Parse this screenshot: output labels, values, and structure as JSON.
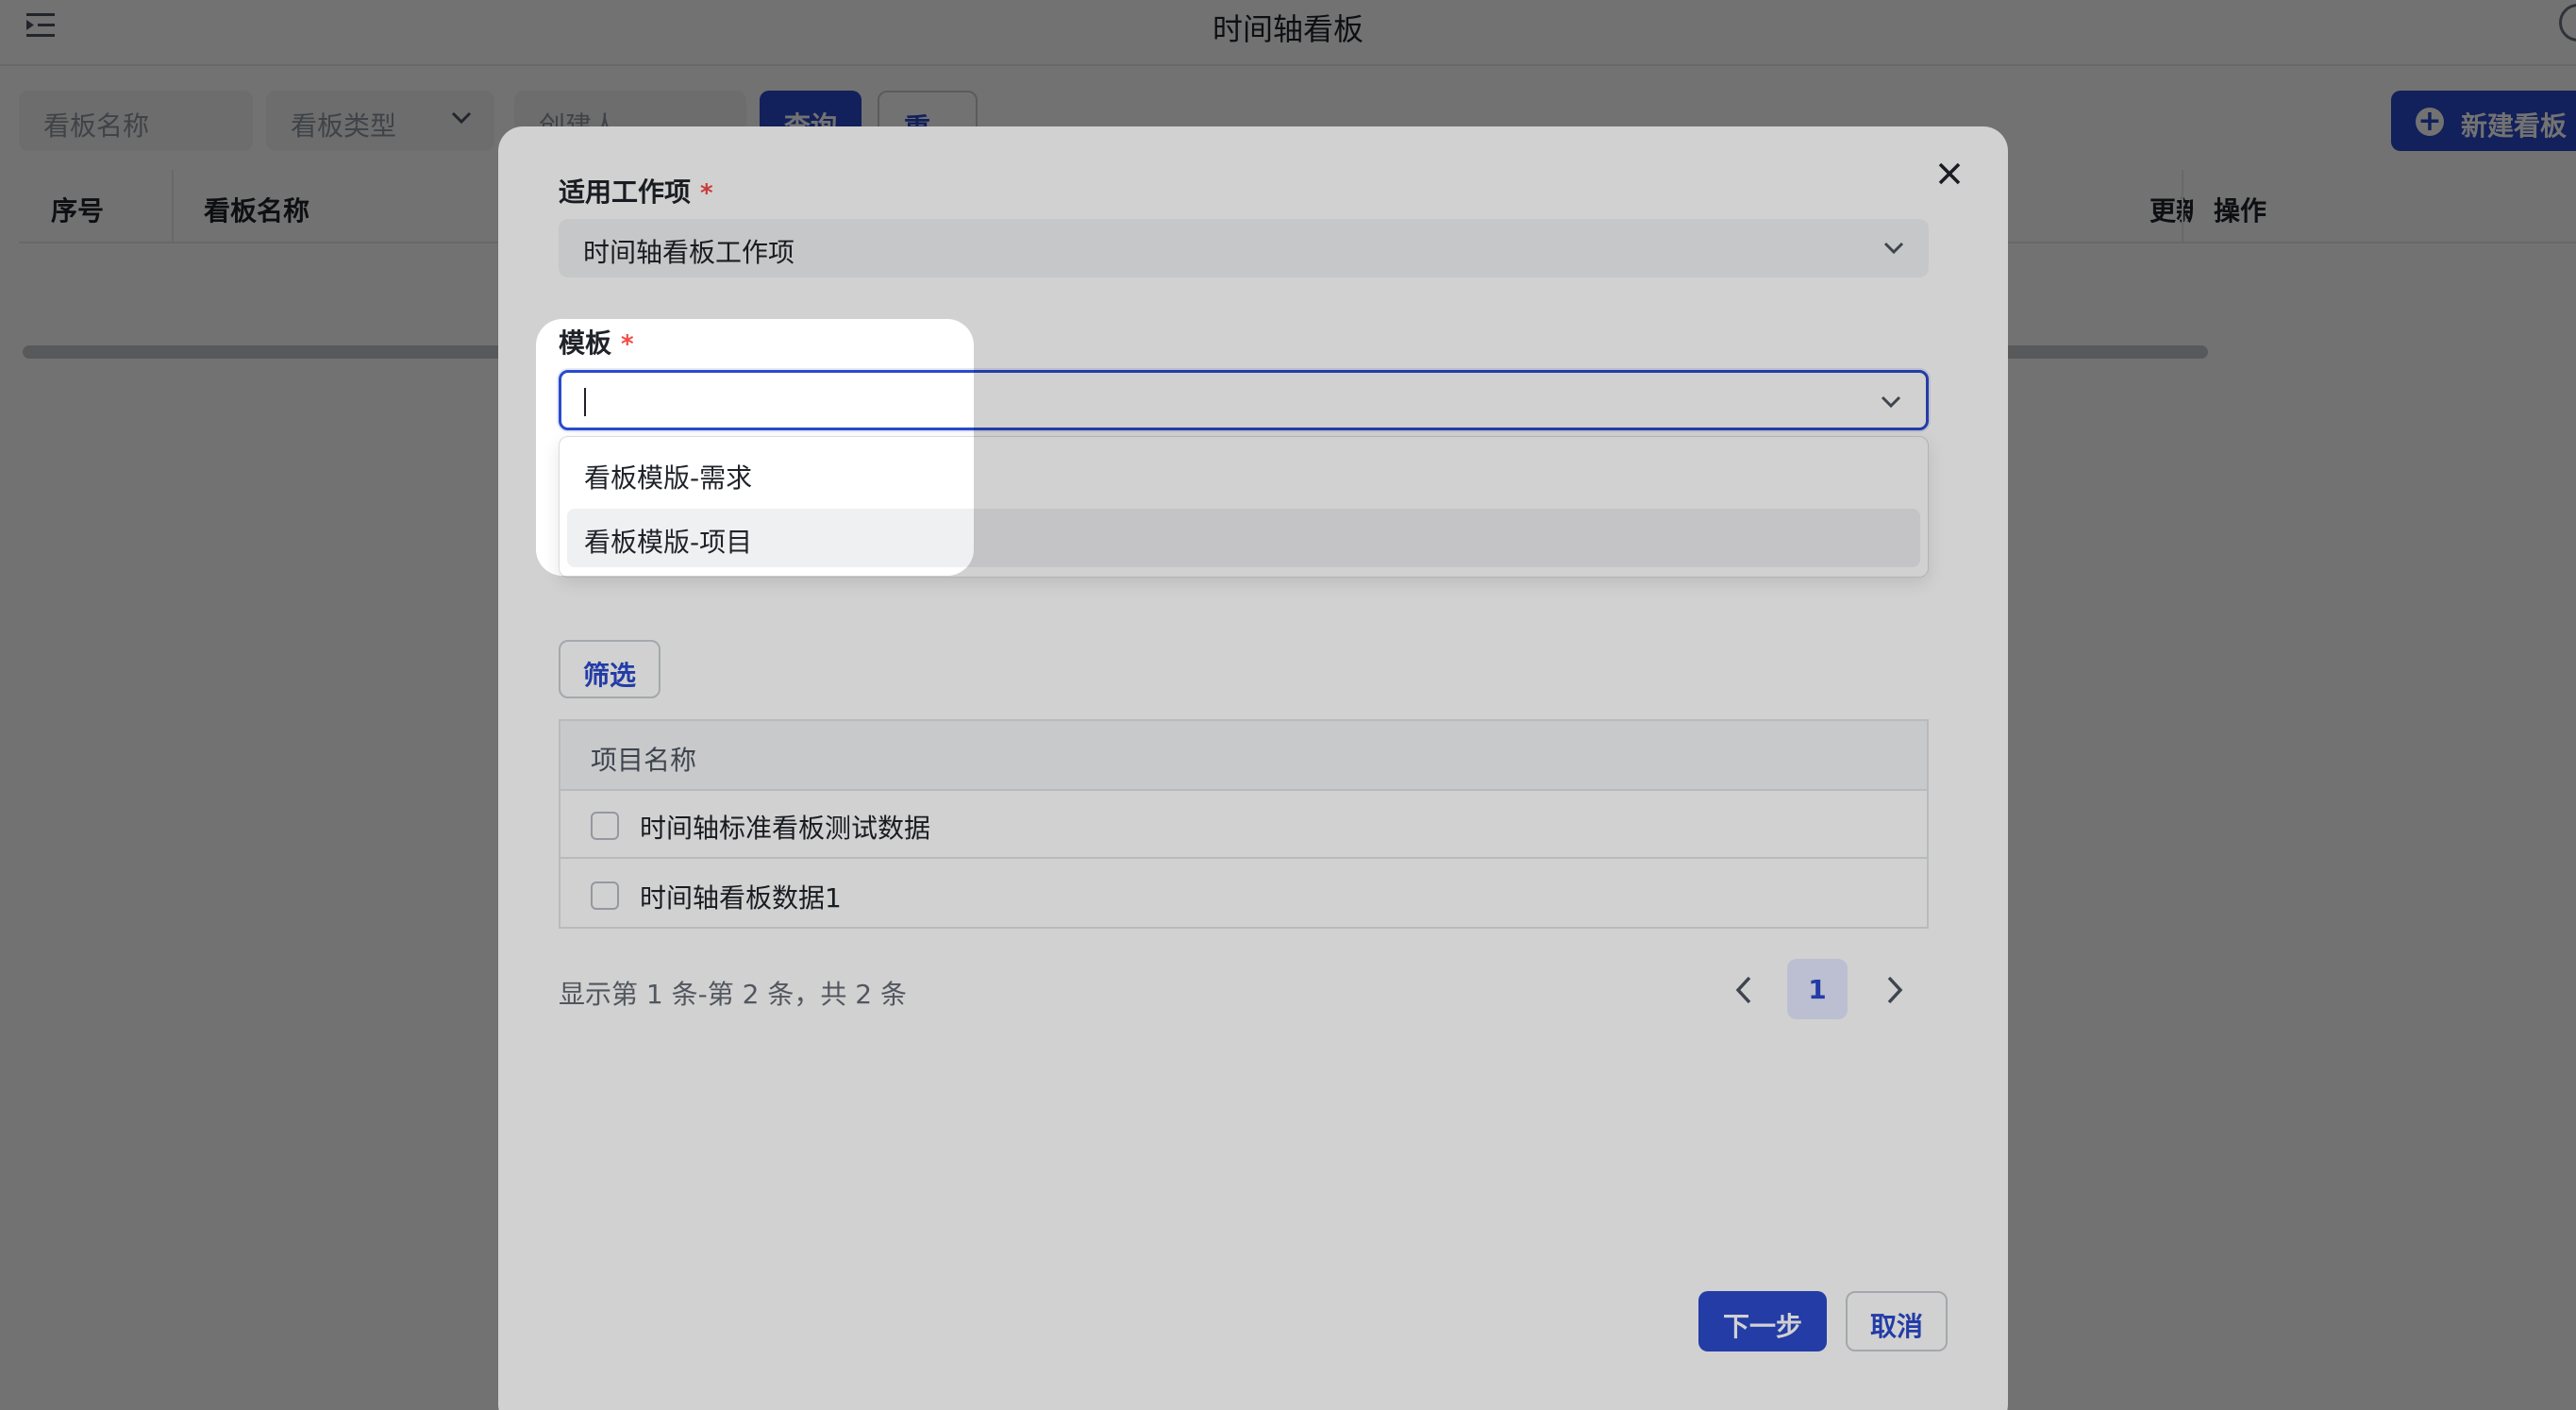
{
  "page": {
    "title": "时间轴看板"
  },
  "filters": {
    "name_placeholder": "看板名称",
    "type_placeholder": "看板类型",
    "creator_placeholder": "创建人",
    "query_label": "查询",
    "reset_label": "重置",
    "new_label": "新建看板"
  },
  "table": {
    "columns": [
      "序号",
      "看板名称",
      "更新",
      "操作"
    ]
  },
  "modal": {
    "workitem": {
      "label": "适用工作项",
      "value": "时间轴看板工作项"
    },
    "template": {
      "label": "模板",
      "value": "",
      "options": [
        "看板模版-需求",
        "看板模版-项目"
      ],
      "hovered_index": 1
    },
    "filter_label": "筛选",
    "project_table": {
      "header": "项目名称",
      "rows": [
        {
          "name": "时间轴标准看板测试数据",
          "checked": false
        },
        {
          "name": "时间轴看板数据1",
          "checked": false
        }
      ]
    },
    "pagination": {
      "info": "显示第 1 条-第 2 条，共 2 条",
      "current_page": "1"
    },
    "next_label": "下一步",
    "cancel_label": "取消"
  },
  "colors": {
    "primary": "#2b4acb",
    "required": "#f54a45"
  }
}
